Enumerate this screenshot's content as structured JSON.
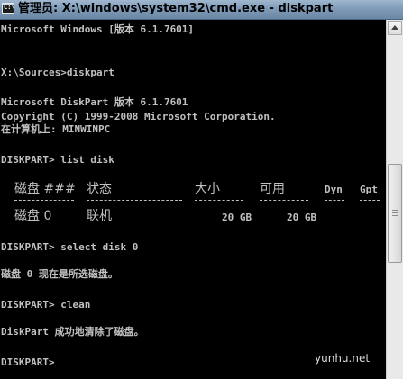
{
  "window": {
    "title": "管理员: X:\\windows\\system32\\cmd.exe - diskpart",
    "icon_name": "cmd-console-icon",
    "icon_glyph": "C:\\"
  },
  "console": {
    "lines": [
      {
        "text": "Microsoft Windows [版本 6.1.7601]"
      },
      {
        "text": "X:\\Sources>diskpart"
      },
      {
        "text": "Microsoft DiskPart 版本 6.1.7601"
      },
      {
        "text": "Copyright (C) 1999-2008 Microsoft Corporation."
      },
      {
        "text": "在计算机上: MINWINPC"
      },
      {
        "text": "DISKPART> list disk"
      },
      {
        "text": "DISKPART> select disk 0"
      },
      {
        "text": "磁盘 0 现在是所选磁盘。"
      },
      {
        "text": "DISKPART> clean"
      },
      {
        "text": "DiskPart 成功地清除了磁盘。"
      },
      {
        "text": "DISKPART>"
      }
    ],
    "disk_table": {
      "columns": [
        "磁盘 ###",
        "状态",
        "大小",
        "可用",
        "Dyn",
        "Gpt"
      ],
      "rows": [
        [
          "磁盘 0",
          "联机",
          "20 GB",
          "20 GB",
          "",
          ""
        ]
      ]
    }
  },
  "watermark": "yunhu.net",
  "colors": {
    "console_background": "#000000",
    "console_text": "#c0c0c0",
    "titlebar": "#7f9bb7"
  }
}
